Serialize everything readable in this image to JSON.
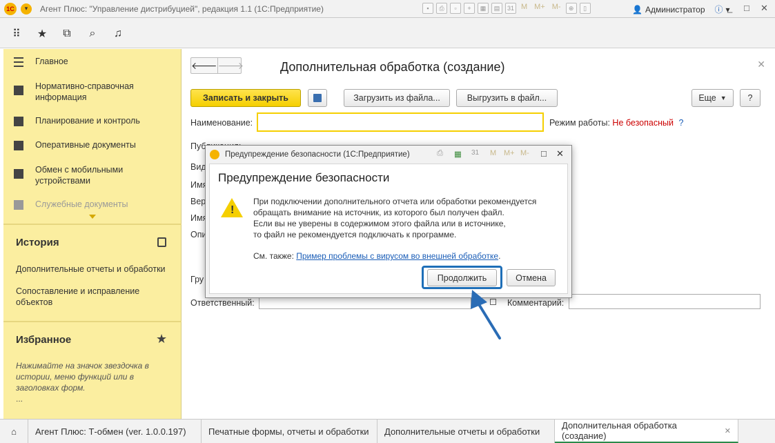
{
  "titlebar": {
    "logo": "1С",
    "title": "Агент Плюс: \"Управление дистрибуцией\", редакция 1.1  (1С:Предприятие)",
    "m_labels": [
      "M",
      "M+",
      "M-"
    ],
    "user": "Администратор"
  },
  "sidebar": {
    "items": [
      {
        "label": "Главное",
        "icon": "menu-lines-icon"
      },
      {
        "label": "Нормативно-справочная информация",
        "icon": "catalog-icon"
      },
      {
        "label": "Планирование и контроль",
        "icon": "chart-icon"
      },
      {
        "label": "Оперативные документы",
        "icon": "documents-icon"
      },
      {
        "label": "Обмен с мобильными устройствами",
        "icon": "sync-icon"
      },
      {
        "label": "Служебные документы",
        "icon": "service-docs-icon"
      }
    ],
    "history": {
      "title": "История",
      "links": [
        "Дополнительные отчеты и обработки",
        "Сопоставление и исправление объектов"
      ]
    },
    "favorites": {
      "title": "Избранное",
      "note": "Нажимайте на значок звездочка в истории, меню функций или в заголовках форм.",
      "ellipsis": "..."
    }
  },
  "form": {
    "title": "Дополнительная обработка (создание)",
    "save_close": "Записать и закрыть",
    "load_file": "Загрузить из файла...",
    "unload_file": "Выгрузить в файл...",
    "more": "Еще",
    "help": "?",
    "name_label": "Наименование:",
    "mode_label": "Режим работы:",
    "mode_value": "Не безопасный",
    "mode_help": "?",
    "publication_label": "Публикация:",
    "labels_partial": [
      "Вид",
      "Имя",
      "Вер",
      "Имя",
      "Опи",
      "Гру"
    ],
    "responsible_label": "Ответственный:",
    "comment_label": "Комментарий:"
  },
  "dialog": {
    "window_title": "Предупреждение безопасности  (1С:Предприятие)",
    "heading": "Предупреждение безопасности",
    "text_lines": [
      "При подключении дополнительного отчета или обработки рекомендуется",
      "обращать внимание на источник, из которого был получен файл.",
      "Если вы не уверены в содержимом этого файла или в источнике,",
      "то файл не рекомендуется подключать к программе."
    ],
    "see_also": "См. также:",
    "link": "Пример проблемы с вирусом во внешней обработке",
    "link_period": ".",
    "continue": "Продолжить",
    "cancel": "Отмена"
  },
  "bottom_tabs": [
    {
      "label": "Агент Плюс: Т-обмен (ver. 1.0.0.197)"
    },
    {
      "label": "Печатные формы, отчеты и обработки"
    },
    {
      "label": "Дополнительные отчеты и обработки"
    },
    {
      "label": "Дополнительная обработка (создание)",
      "active": true
    }
  ],
  "colors": {
    "accent_yellow": "#f5cf00",
    "sidebar": "#fbeea0",
    "highlight_blue": "#1f6fb8",
    "warning_red": "#cc0000"
  }
}
